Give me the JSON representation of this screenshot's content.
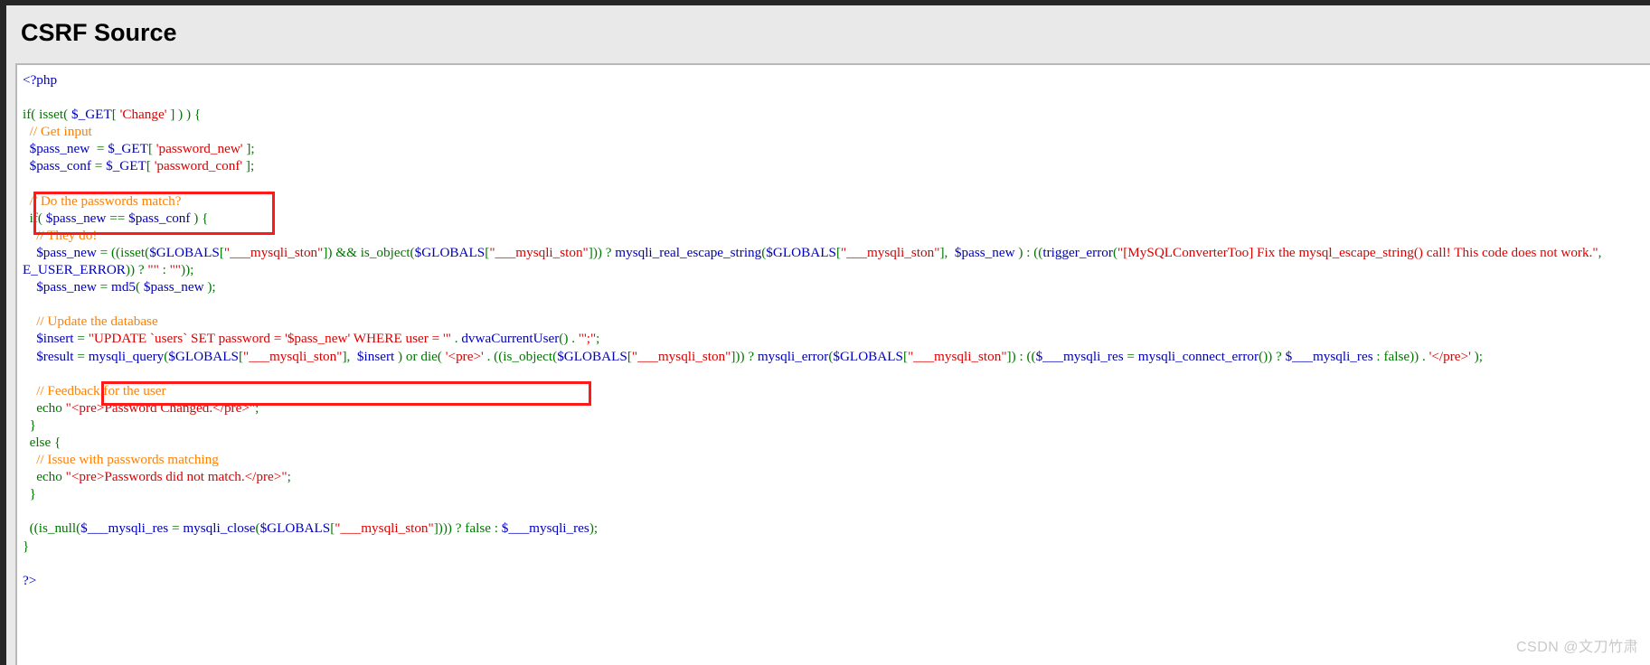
{
  "page": {
    "title": "CSRF Source",
    "watermark": "CSDN @文刀竹肃"
  },
  "colors": {
    "page_background": "#e9e9e9",
    "code_background": "#ffffff",
    "annotation": "#ff1a1a",
    "php_tag": "#0000bb",
    "keyword": "#007700",
    "variable": "#0000bb",
    "string": "#dd0000",
    "comment": "#ff8000",
    "watermark": "#c9c9c9"
  },
  "annotations": [
    {
      "name": "get-input-highlight",
      "label": "red rectangle around the two $_GET input lines"
    },
    {
      "name": "sql-update-highlight",
      "label": "red rectangle around the UPDATE users SQL string"
    }
  ],
  "code": {
    "language": "php",
    "lines": [
      {
        "tokens": [
          {
            "t": "tag",
            "v": "<?php"
          }
        ]
      },
      {
        "tokens": []
      },
      {
        "tokens": [
          {
            "t": "kw",
            "v": "if( "
          },
          {
            "t": "kw",
            "v": "isset"
          },
          {
            "t": "kw",
            "v": "( "
          },
          {
            "t": "var",
            "v": "$_GET"
          },
          {
            "t": "kw",
            "v": "[ "
          },
          {
            "t": "str",
            "v": "'Change'"
          },
          {
            "t": "kw",
            "v": " ] ) ) {"
          }
        ]
      },
      {
        "tokens": [
          {
            "t": "plain",
            "v": "  "
          },
          {
            "t": "com",
            "v": "// Get input"
          }
        ]
      },
      {
        "tokens": [
          {
            "t": "plain",
            "v": "  "
          },
          {
            "t": "var",
            "v": "$pass_new"
          },
          {
            "t": "kw",
            "v": "  = "
          },
          {
            "t": "var",
            "v": "$_GET"
          },
          {
            "t": "kw",
            "v": "[ "
          },
          {
            "t": "str",
            "v": "'password_new'"
          },
          {
            "t": "kw",
            "v": " ];"
          }
        ]
      },
      {
        "tokens": [
          {
            "t": "plain",
            "v": "  "
          },
          {
            "t": "var",
            "v": "$pass_conf"
          },
          {
            "t": "kw",
            "v": " = "
          },
          {
            "t": "var",
            "v": "$_GET"
          },
          {
            "t": "kw",
            "v": "[ "
          },
          {
            "t": "str",
            "v": "'password_conf'"
          },
          {
            "t": "kw",
            "v": " ];"
          }
        ]
      },
      {
        "tokens": []
      },
      {
        "tokens": [
          {
            "t": "plain",
            "v": "  "
          },
          {
            "t": "com",
            "v": "// Do the passwords match?"
          }
        ]
      },
      {
        "tokens": [
          {
            "t": "plain",
            "v": "  "
          },
          {
            "t": "kw",
            "v": "if( "
          },
          {
            "t": "var",
            "v": "$pass_new"
          },
          {
            "t": "kw",
            "v": " == "
          },
          {
            "t": "var",
            "v": "$pass_conf"
          },
          {
            "t": "kw",
            "v": " ) {"
          }
        ]
      },
      {
        "tokens": [
          {
            "t": "plain",
            "v": "    "
          },
          {
            "t": "com",
            "v": "// They do!"
          }
        ]
      },
      {
        "tokens": [
          {
            "t": "plain",
            "v": "    "
          },
          {
            "t": "var",
            "v": "$pass_new"
          },
          {
            "t": "kw",
            "v": " = (("
          },
          {
            "t": "kw",
            "v": "isset"
          },
          {
            "t": "kw",
            "v": "("
          },
          {
            "t": "var",
            "v": "$GLOBALS"
          },
          {
            "t": "kw",
            "v": "["
          },
          {
            "t": "str",
            "v": "\"___mysqli_ston\""
          },
          {
            "t": "kw",
            "v": "]) && "
          },
          {
            "t": "kw",
            "v": "is_object"
          },
          {
            "t": "kw",
            "v": "("
          },
          {
            "t": "var",
            "v": "$GLOBALS"
          },
          {
            "t": "kw",
            "v": "["
          },
          {
            "t": "str",
            "v": "\"___mysqli_ston\""
          },
          {
            "t": "kw",
            "v": "])) ? "
          },
          {
            "t": "var",
            "v": "mysqli_real_escape_string"
          },
          {
            "t": "kw",
            "v": "("
          },
          {
            "t": "var",
            "v": "$GLOBALS"
          },
          {
            "t": "kw",
            "v": "["
          },
          {
            "t": "str",
            "v": "\"___mysqli_ston\""
          },
          {
            "t": "kw",
            "v": "],  "
          },
          {
            "t": "var",
            "v": "$pass_new"
          },
          {
            "t": "kw",
            "v": " ) : (("
          },
          {
            "t": "var",
            "v": "trigger_error"
          },
          {
            "t": "kw",
            "v": "("
          },
          {
            "t": "str",
            "v": "\"[MySQLConverterToo] Fix the mysql_escape_string() call! This code does not work.\""
          },
          {
            "t": "kw",
            "v": ", "
          },
          {
            "t": "var",
            "v": "E_USER_ERROR"
          },
          {
            "t": "kw",
            "v": ")) ? "
          },
          {
            "t": "str",
            "v": "\"\""
          },
          {
            "t": "kw",
            "v": " : "
          },
          {
            "t": "str",
            "v": "\"\""
          },
          {
            "t": "kw",
            "v": "));"
          }
        ]
      },
      {
        "tokens": [
          {
            "t": "plain",
            "v": "    "
          },
          {
            "t": "var",
            "v": "$pass_new"
          },
          {
            "t": "kw",
            "v": " = "
          },
          {
            "t": "var",
            "v": "md5"
          },
          {
            "t": "kw",
            "v": "( "
          },
          {
            "t": "var",
            "v": "$pass_new"
          },
          {
            "t": "kw",
            "v": " );"
          }
        ]
      },
      {
        "tokens": []
      },
      {
        "tokens": [
          {
            "t": "plain",
            "v": "    "
          },
          {
            "t": "com",
            "v": "// Update the database"
          }
        ]
      },
      {
        "tokens": [
          {
            "t": "plain",
            "v": "    "
          },
          {
            "t": "var",
            "v": "$insert"
          },
          {
            "t": "kw",
            "v": " = "
          },
          {
            "t": "str",
            "v": "\"UPDATE `users` SET password = '$pass_new' WHERE user = '\""
          },
          {
            "t": "kw",
            "v": " . "
          },
          {
            "t": "var",
            "v": "dvwaCurrentUser"
          },
          {
            "t": "kw",
            "v": "() . "
          },
          {
            "t": "str",
            "v": "\"';\""
          },
          {
            "t": "kw",
            "v": ";"
          }
        ]
      },
      {
        "tokens": [
          {
            "t": "plain",
            "v": "    "
          },
          {
            "t": "var",
            "v": "$result"
          },
          {
            "t": "kw",
            "v": " = "
          },
          {
            "t": "var",
            "v": "mysqli_query"
          },
          {
            "t": "kw",
            "v": "("
          },
          {
            "t": "var",
            "v": "$GLOBALS"
          },
          {
            "t": "kw",
            "v": "["
          },
          {
            "t": "str",
            "v": "\"___mysqli_ston\""
          },
          {
            "t": "kw",
            "v": "],  "
          },
          {
            "t": "var",
            "v": "$insert"
          },
          {
            "t": "kw",
            "v": " ) or die( "
          },
          {
            "t": "str",
            "v": "'<pre>'"
          },
          {
            "t": "kw",
            "v": " . (("
          },
          {
            "t": "kw",
            "v": "is_object"
          },
          {
            "t": "kw",
            "v": "("
          },
          {
            "t": "var",
            "v": "$GLOBALS"
          },
          {
            "t": "kw",
            "v": "["
          },
          {
            "t": "str",
            "v": "\"___mysqli_ston\""
          },
          {
            "t": "kw",
            "v": "])) ? "
          },
          {
            "t": "var",
            "v": "mysqli_error"
          },
          {
            "t": "kw",
            "v": "("
          },
          {
            "t": "var",
            "v": "$GLOBALS"
          },
          {
            "t": "kw",
            "v": "["
          },
          {
            "t": "str",
            "v": "\"___mysqli_ston\""
          },
          {
            "t": "kw",
            "v": "]) : (("
          },
          {
            "t": "var",
            "v": "$___mysqli_res"
          },
          {
            "t": "kw",
            "v": " = "
          },
          {
            "t": "var",
            "v": "mysqli_connect_error"
          },
          {
            "t": "kw",
            "v": "()) ? "
          },
          {
            "t": "var",
            "v": "$___mysqli_res"
          },
          {
            "t": "kw",
            "v": " : "
          },
          {
            "t": "kw",
            "v": "false"
          },
          {
            "t": "kw",
            "v": ")) . "
          },
          {
            "t": "str",
            "v": "'</pre>'"
          },
          {
            "t": "kw",
            "v": " );"
          }
        ]
      },
      {
        "tokens": []
      },
      {
        "tokens": [
          {
            "t": "plain",
            "v": "    "
          },
          {
            "t": "com",
            "v": "// Feedback for the user"
          }
        ]
      },
      {
        "tokens": [
          {
            "t": "plain",
            "v": "    "
          },
          {
            "t": "kw",
            "v": "echo "
          },
          {
            "t": "str",
            "v": "\"<pre>Password Changed.</pre>\""
          },
          {
            "t": "kw",
            "v": ";"
          }
        ]
      },
      {
        "tokens": [
          {
            "t": "plain",
            "v": "  "
          },
          {
            "t": "kw",
            "v": "}"
          }
        ]
      },
      {
        "tokens": [
          {
            "t": "plain",
            "v": "  "
          },
          {
            "t": "kw",
            "v": "else {"
          }
        ]
      },
      {
        "tokens": [
          {
            "t": "plain",
            "v": "    "
          },
          {
            "t": "com",
            "v": "// Issue with passwords matching"
          }
        ]
      },
      {
        "tokens": [
          {
            "t": "plain",
            "v": "    "
          },
          {
            "t": "kw",
            "v": "echo "
          },
          {
            "t": "str",
            "v": "\"<pre>Passwords did not match.</pre>\""
          },
          {
            "t": "kw",
            "v": ";"
          }
        ]
      },
      {
        "tokens": [
          {
            "t": "plain",
            "v": "  "
          },
          {
            "t": "kw",
            "v": "}"
          }
        ]
      },
      {
        "tokens": []
      },
      {
        "tokens": [
          {
            "t": "plain",
            "v": "  "
          },
          {
            "t": "kw",
            "v": "(("
          },
          {
            "t": "kw",
            "v": "is_null"
          },
          {
            "t": "kw",
            "v": "("
          },
          {
            "t": "var",
            "v": "$___mysqli_res"
          },
          {
            "t": "kw",
            "v": " = "
          },
          {
            "t": "var",
            "v": "mysqli_close"
          },
          {
            "t": "kw",
            "v": "("
          },
          {
            "t": "var",
            "v": "$GLOBALS"
          },
          {
            "t": "kw",
            "v": "["
          },
          {
            "t": "str",
            "v": "\"___mysqli_ston\""
          },
          {
            "t": "kw",
            "v": "]))) ? "
          },
          {
            "t": "kw",
            "v": "false"
          },
          {
            "t": "kw",
            "v": " : "
          },
          {
            "t": "var",
            "v": "$___mysqli_res"
          },
          {
            "t": "kw",
            "v": ");"
          }
        ]
      },
      {
        "tokens": [
          {
            "t": "kw",
            "v": "}"
          }
        ]
      },
      {
        "tokens": []
      },
      {
        "tokens": [
          {
            "t": "tag",
            "v": "?>"
          }
        ]
      }
    ]
  }
}
